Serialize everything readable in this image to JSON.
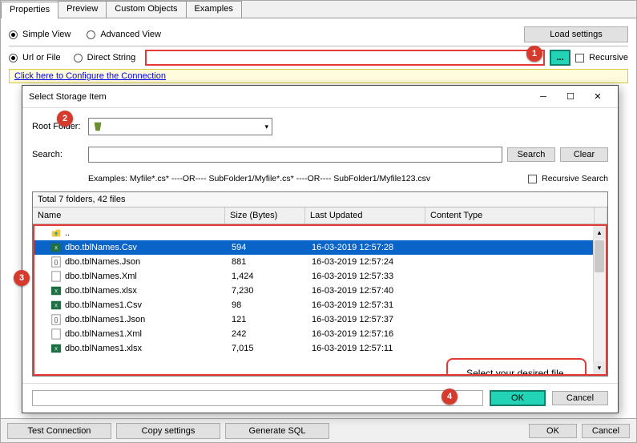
{
  "tabs": [
    "Properties",
    "Preview",
    "Custom Objects",
    "Examples"
  ],
  "active_tab": 0,
  "view": {
    "simple": "Simple View",
    "advanced": "Advanced View"
  },
  "load_settings": "Load settings",
  "source": {
    "url_or_file": "Url or File",
    "direct_string": "Direct String"
  },
  "browse_btn": "...",
  "recursive": "Recursive",
  "configure_link": "Click here to Configure the Connection",
  "dialog": {
    "title": "Select Storage Item",
    "root_folder_label": "Root Folder:",
    "root_folder_value": "",
    "search_label": "Search:",
    "search_btn": "Search",
    "clear_btn": "Clear",
    "examples": "Examples:  Myfile*.cs*   ----OR----   SubFolder1/Myfile*.cs*   ----OR----   SubFolder1/Myfile123.csv",
    "recursive_search": "Recursive Search",
    "summary": "Total 7 folders, 42 files",
    "columns": [
      "Name",
      "Size (Bytes)",
      "Last Updated",
      "Content Type"
    ],
    "up_label": "..",
    "rows": [
      {
        "icon": "csv",
        "name": "dbo.tblNames.Csv",
        "size": "594",
        "date": "16-03-2019 12:57:28",
        "sel": true
      },
      {
        "icon": "json",
        "name": "dbo.tblNames.Json",
        "size": "881",
        "date": "16-03-2019 12:57:24"
      },
      {
        "icon": "xml",
        "name": "dbo.tblNames.Xml",
        "size": "1,424",
        "date": "16-03-2019 12:57:33"
      },
      {
        "icon": "xlsx",
        "name": "dbo.tblNames.xlsx",
        "size": "7,230",
        "date": "16-03-2019 12:57:40"
      },
      {
        "icon": "csv",
        "name": "dbo.tblNames1.Csv",
        "size": "98",
        "date": "16-03-2019 12:57:31"
      },
      {
        "icon": "json",
        "name": "dbo.tblNames1.Json",
        "size": "121",
        "date": "16-03-2019 12:57:37"
      },
      {
        "icon": "xml",
        "name": "dbo.tblNames1.Xml",
        "size": "242",
        "date": "16-03-2019 12:57:16"
      },
      {
        "icon": "xlsx",
        "name": "dbo.tblNames1.xlsx",
        "size": "7,015",
        "date": "16-03-2019 12:57:11"
      }
    ],
    "ok": "OK",
    "cancel": "Cancel"
  },
  "callout": "Select your desired file, which you want to read",
  "footer": {
    "test": "Test Connection",
    "copy": "Copy settings",
    "gensql": "Generate SQL",
    "ok": "OK",
    "cancel": "Cancel"
  },
  "markers": [
    "1",
    "2",
    "3",
    "4"
  ]
}
